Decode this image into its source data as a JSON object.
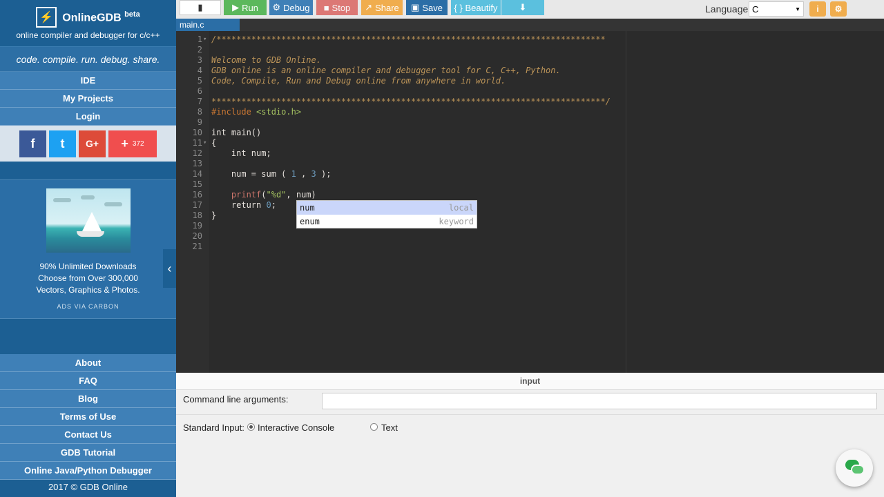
{
  "sidebar": {
    "logo_glyph": "⚡",
    "brand": "OnlineGDB",
    "brand_beta": "beta",
    "brand_sub": "online compiler and debugger for c/c++",
    "tagline": "code. compile. run. debug. share.",
    "nav": [
      "IDE",
      "My Projects",
      "Login"
    ],
    "social": {
      "facebook": "f",
      "twitter": "t",
      "googleplus": "G+",
      "plus_count": "372"
    },
    "ad": {
      "line1": "90% Unlimited Downloads",
      "line2": "Choose from Over 300,000",
      "line3": "Vectors, Graphics & Photos.",
      "via": "ADS VIA CARBON"
    },
    "footer_links": [
      "About",
      "FAQ",
      "Blog",
      "Terms of Use",
      "Contact Us",
      "GDB Tutorial",
      "Online Java/Python Debugger"
    ],
    "copyright": "2017 © GDB Online",
    "collapse_icon": "‹"
  },
  "toolbar": {
    "file_icon": "▮",
    "run": "Run",
    "debug": "Debug",
    "stop": "Stop",
    "share": "Share",
    "save": "Save",
    "beautify": "{ } Beautify",
    "download_icon": "⬇",
    "language_label": "Language",
    "language_value": "C",
    "info_icon": "i",
    "settings_icon": "⚙"
  },
  "editor": {
    "tab": "main.c",
    "lines": [
      {
        "n": "1",
        "fold": "▾",
        "html": "<span class='comment'>/******************************************************************************</span>"
      },
      {
        "n": "2",
        "fold": "",
        "html": ""
      },
      {
        "n": "3",
        "fold": "",
        "html": "<span class='comment'>Welcome to GDB Online.</span>"
      },
      {
        "n": "4",
        "fold": "",
        "html": "<span class='comment'>GDB online is an online compiler and debugger tool for C, C++, Python.</span>"
      },
      {
        "n": "5",
        "fold": "",
        "html": "<span class='comment'>Code, Compile, Run and Debug online from anywhere in world.</span>"
      },
      {
        "n": "6",
        "fold": "",
        "html": ""
      },
      {
        "n": "7",
        "fold": "",
        "html": "<span class='comment'>*******************************************************************************/</span>"
      },
      {
        "n": "8",
        "fold": "",
        "html": "<span class='pre'>#include</span> <span class='str'>&lt;stdio.h&gt;</span>"
      },
      {
        "n": "9",
        "fold": "",
        "html": ""
      },
      {
        "n": "10",
        "fold": "",
        "html": "int main()"
      },
      {
        "n": "11",
        "fold": "▾",
        "html": "{"
      },
      {
        "n": "12",
        "fold": "",
        "html": "    int num;"
      },
      {
        "n": "13",
        "fold": "",
        "html": ""
      },
      {
        "n": "14",
        "fold": "",
        "html": "    num = sum ( <span class='num'>1</span> , <span class='num'>3</span> );"
      },
      {
        "n": "15",
        "fold": "",
        "html": ""
      },
      {
        "n": "16",
        "fold": "",
        "html": "    <span class='faded'>printf</span>(<span class='str'>\"%d\"</span>, num)"
      },
      {
        "n": "17",
        "fold": "",
        "html": "    return <span class='num'>0</span>;"
      },
      {
        "n": "18",
        "fold": "",
        "html": "}"
      },
      {
        "n": "19",
        "fold": "",
        "html": ""
      },
      {
        "n": "20",
        "fold": "",
        "html": ""
      },
      {
        "n": "21",
        "fold": "",
        "html": ""
      }
    ],
    "autocomplete": [
      {
        "word": "num",
        "type": "local"
      },
      {
        "word": "enum",
        "type": "keyword"
      }
    ]
  },
  "input_panel": {
    "header": "input",
    "cla_label": "Command line arguments:",
    "cla_value": "",
    "stdin_label": "Standard Input:",
    "option_interactive": "Interactive Console",
    "option_text": "Text"
  },
  "colors": {
    "sidebar": "#1c5f93",
    "run": "#5cb85c",
    "stop": "#d9534f",
    "share": "#f0ad4e",
    "editor_bg": "#2b2b2b"
  }
}
